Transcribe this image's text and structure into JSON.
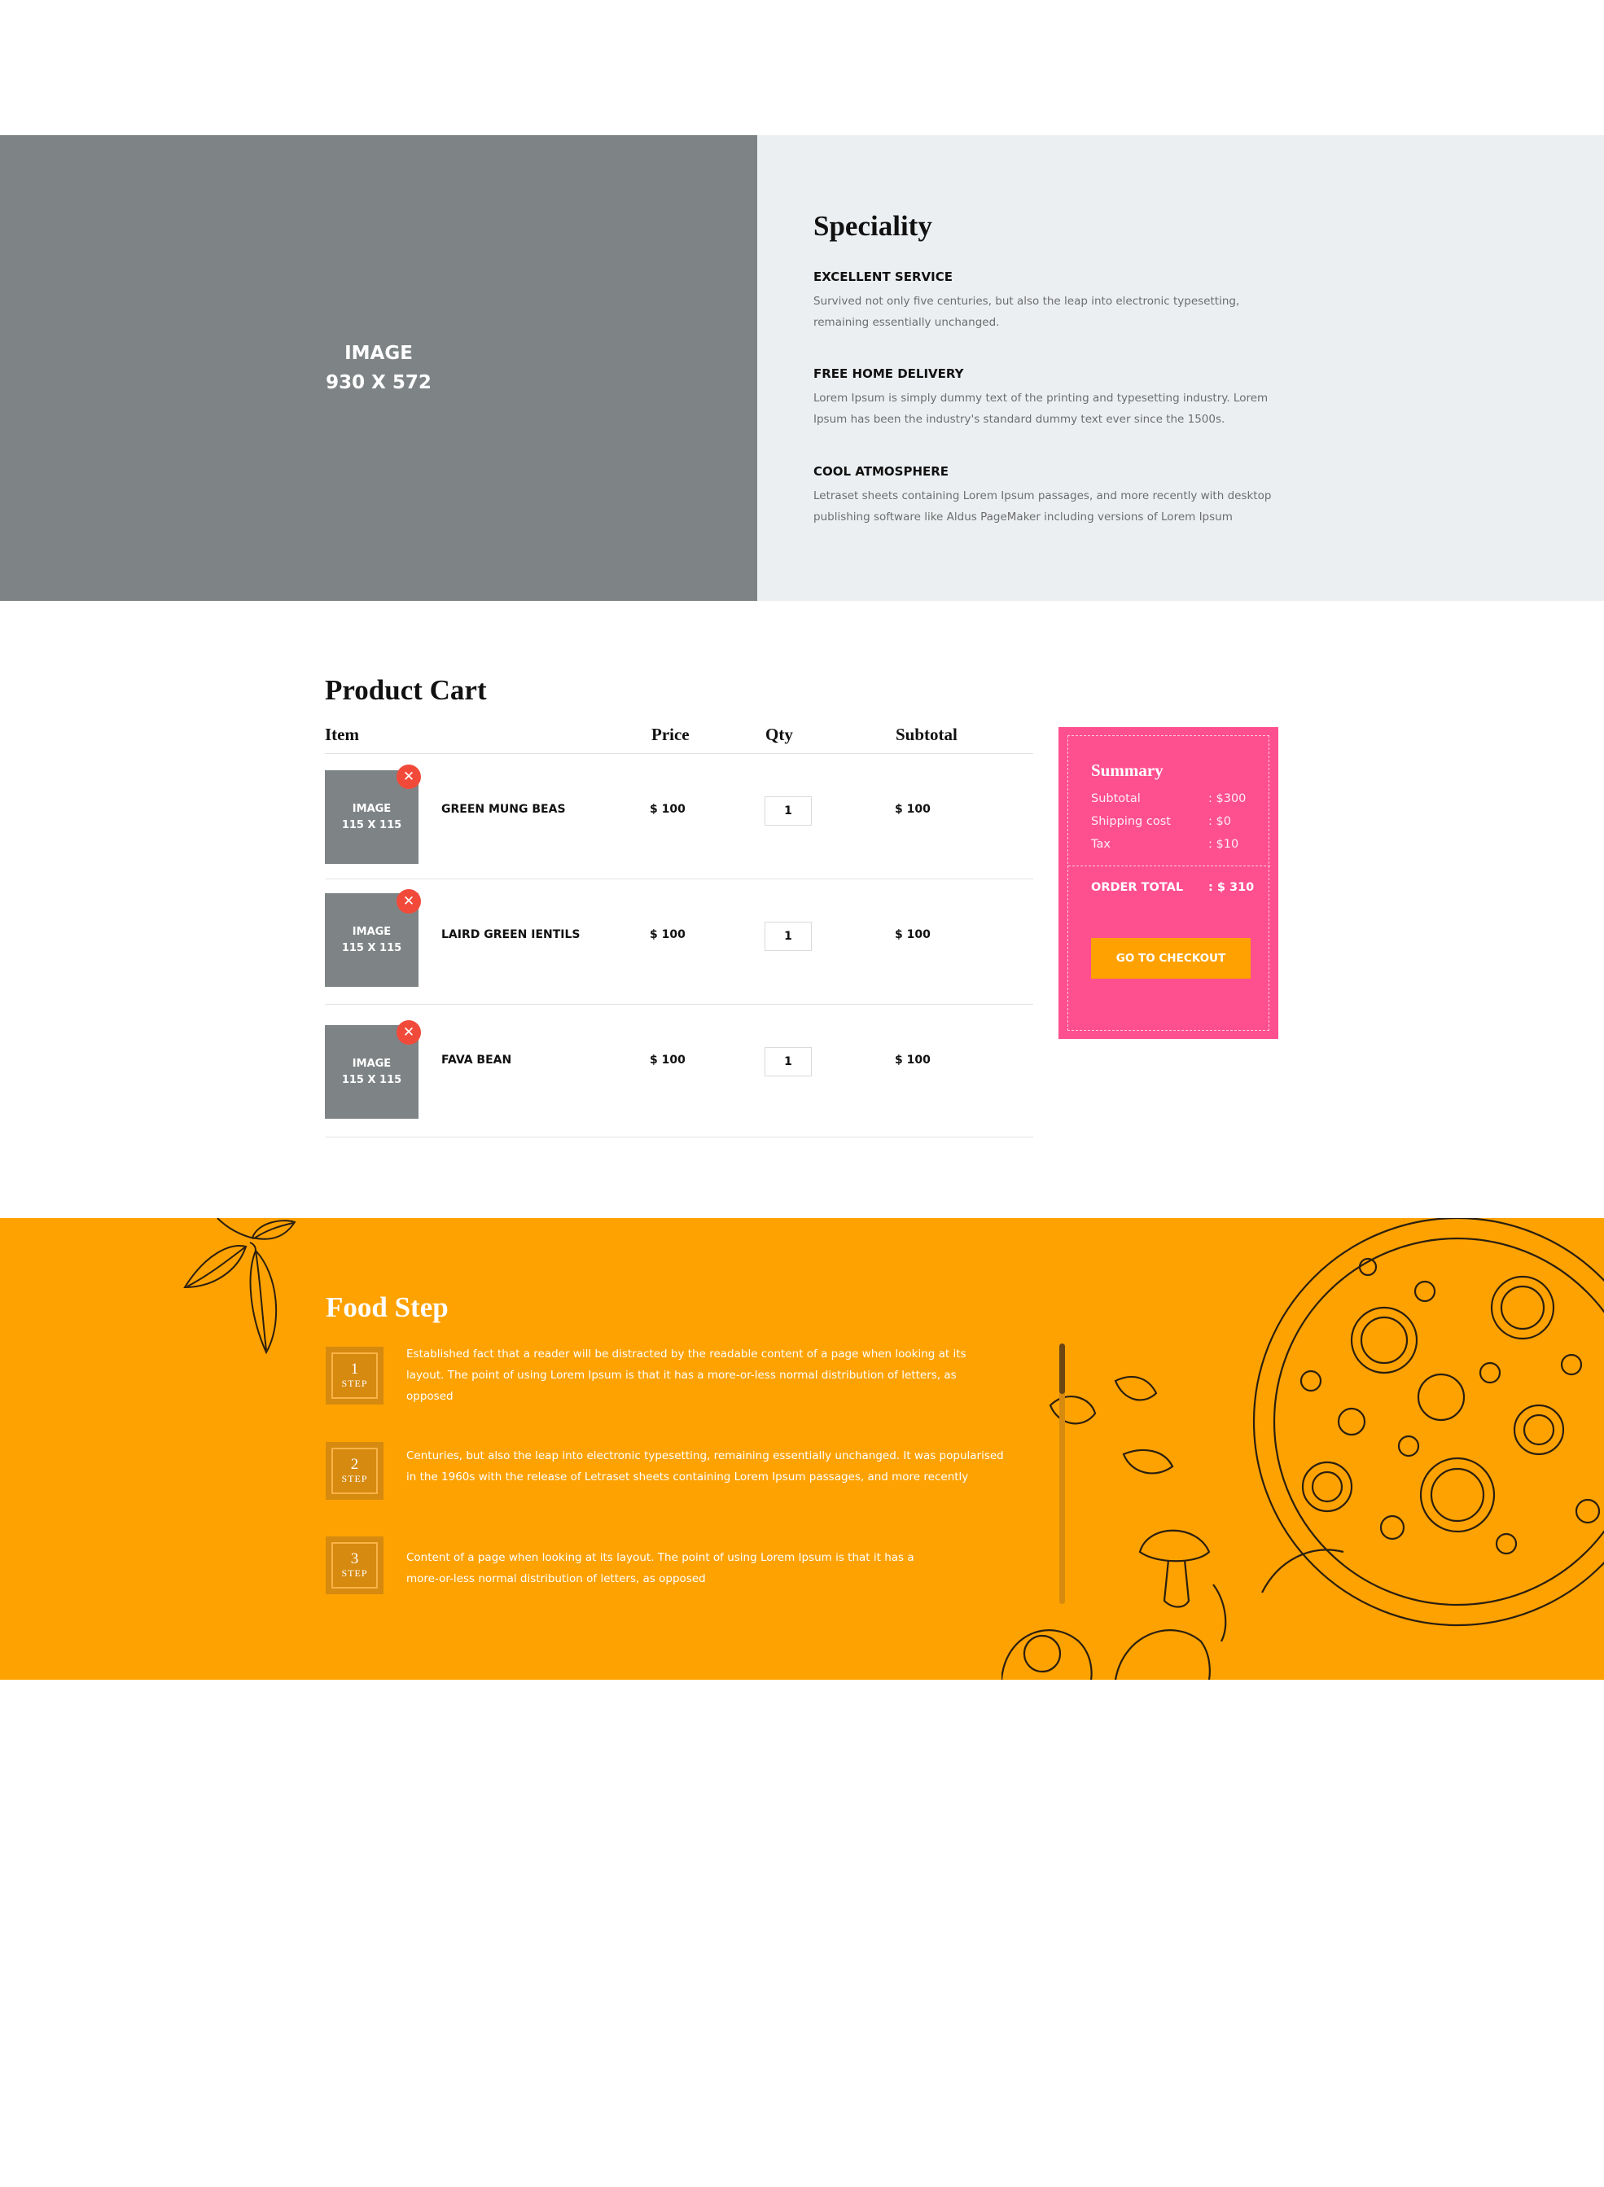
{
  "speciality": {
    "image_placeholder": {
      "line1": "IMAGE",
      "line2": "930 X 572"
    },
    "title": "Speciality",
    "features": [
      {
        "heading": "EXCELLENT SERVICE",
        "text1": "Survived not only five centuries, but also the leap into electronic typesetting,",
        "text2": "remaining essentially unchanged."
      },
      {
        "heading": "FREE HOME DELIVERY",
        "text1": "Lorem Ipsum is simply dummy text of the printing and typesetting industry. Lorem",
        "text2": "Ipsum has been the industry's standard dummy text ever since the 1500s."
      },
      {
        "heading": "COOL ATMOSPHERE",
        "text1": "Letraset sheets containing Lorem Ipsum passages, and more recently with desktop",
        "text2": "publishing software like Aldus PageMaker including versions of Lorem Ipsum"
      }
    ]
  },
  "cart": {
    "title": "Product Cart",
    "columns": {
      "item": "Item",
      "price": "Price",
      "qty": "Qty",
      "subtotal": "Subtotal"
    },
    "items": [
      {
        "thumb1": "IMAGE",
        "thumb2": "115 X 115",
        "name": "GREEN MUNG BEAS",
        "price": "$ 100",
        "qty": "1",
        "subtotal": "$ 100",
        "remove": "✕"
      },
      {
        "thumb1": "IMAGE",
        "thumb2": "115 X 115",
        "name": "LAIRD GREEN IENTILS",
        "price": "$ 100",
        "qty": "1",
        "subtotal": "$ 100",
        "remove": "✕"
      },
      {
        "thumb1": "IMAGE",
        "thumb2": "115 X 115",
        "name": "FAVA BEAN",
        "price": "$ 100",
        "qty": "1",
        "subtotal": "$ 100",
        "remove": "✕"
      }
    ]
  },
  "summary": {
    "title": "Summary",
    "rows": [
      {
        "label": "Subtotal",
        "value": ": $300"
      },
      {
        "label": "Shipping cost",
        "value": ": $0"
      },
      {
        "label": "Tax",
        "value": ": $10"
      }
    ],
    "total_label": "ORDER TOTAL",
    "total_value": ": $ 310",
    "checkout_label": "GO TO CHECKOUT"
  },
  "food_step": {
    "title": "Food Step",
    "step_label": "STEP",
    "steps": [
      {
        "number": "1",
        "line1": "Established fact that a reader will be distracted by the readable content of a page when looking at its",
        "line2": "layout. The point of using Lorem Ipsum is that it has a more-or-less normal distribution of letters, as",
        "line3": "opposed"
      },
      {
        "number": "2",
        "line1": "Centuries, but also the leap into electronic typesetting, remaining essentially unchanged. It was popularised",
        "line2": "in the 1960s with the release of Letraset sheets containing Lorem Ipsum passages, and more recently"
      },
      {
        "number": "3",
        "line1": "Content of a page when looking at its layout. The point of using Lorem Ipsum is that it has a",
        "line2": "more-or-less normal distribution of letters, as opposed"
      }
    ]
  },
  "colors": {
    "placeholder": "#7e8485",
    "panel": "#eceff2",
    "summary": "#fe4f8f",
    "accent": "#ffa201",
    "remove": "#f24a3a",
    "step_box": "#d68a10"
  }
}
